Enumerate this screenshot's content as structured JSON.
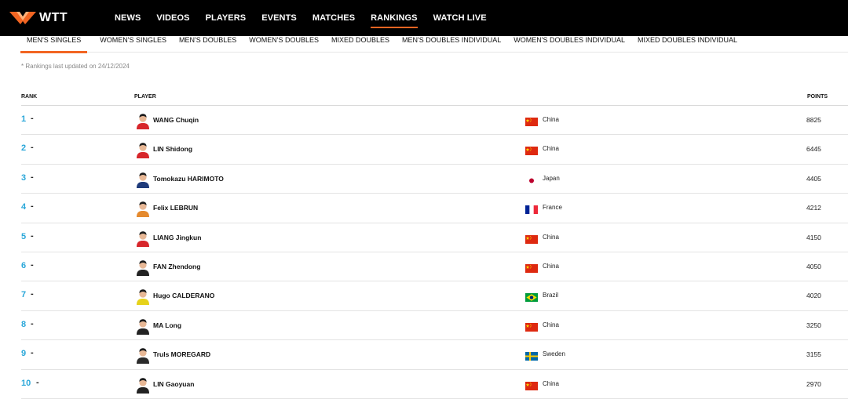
{
  "brand": {
    "name": "WTT"
  },
  "nav": {
    "items": [
      {
        "label": "NEWS"
      },
      {
        "label": "VIDEOS"
      },
      {
        "label": "PLAYERS"
      },
      {
        "label": "EVENTS"
      },
      {
        "label": "MATCHES"
      },
      {
        "label": "RANKINGS",
        "active": true
      },
      {
        "label": "WATCH LIVE"
      }
    ]
  },
  "subtabs": {
    "items": [
      {
        "label": "MEN'S SINGLES",
        "active": true
      },
      {
        "label": "WOMEN'S SINGLES"
      },
      {
        "label": "MEN'S DOUBLES"
      },
      {
        "label": "WOMEN'S DOUBLES"
      },
      {
        "label": "MIXED DOUBLES"
      },
      {
        "label": "MEN'S DOUBLES INDIVIDUAL"
      },
      {
        "label": "WOMEN'S DOUBLES INDIVIDUAL"
      },
      {
        "label": "MIXED DOUBLES INDIVIDUAL"
      }
    ]
  },
  "updated_text": "* Rankings last updated on 24/12/2024",
  "table": {
    "headers": {
      "rank": "RANK",
      "player": "PLAYER",
      "points": "POINTS"
    },
    "rows": [
      {
        "rank": "1",
        "change": "-",
        "player": "WANG Chuqin",
        "country": "China",
        "flag": "china-flag",
        "points": "8825",
        "shirt": "#d7262b"
      },
      {
        "rank": "2",
        "change": "-",
        "player": "LIN Shidong",
        "country": "China",
        "flag": "china-flag",
        "points": "6445",
        "shirt": "#d7262b"
      },
      {
        "rank": "3",
        "change": "-",
        "player": "Tomokazu HARIMOTO",
        "country": "Japan",
        "flag": "japan-flag",
        "points": "4405",
        "shirt": "#1f3b7a"
      },
      {
        "rank": "4",
        "change": "-",
        "player": "Felix LEBRUN",
        "country": "France",
        "flag": "france-flag",
        "points": "4212",
        "shirt": "#e58a2e"
      },
      {
        "rank": "5",
        "change": "-",
        "player": "LIANG Jingkun",
        "country": "China",
        "flag": "china-flag",
        "points": "4150",
        "shirt": "#d7262b"
      },
      {
        "rank": "6",
        "change": "-",
        "player": "FAN Zhendong",
        "country": "China",
        "flag": "china-flag",
        "points": "4050",
        "shirt": "#222222"
      },
      {
        "rank": "7",
        "change": "-",
        "player": "Hugo CALDERANO",
        "country": "Brazil",
        "flag": "brazil-flag",
        "points": "4020",
        "shirt": "#e6d21a"
      },
      {
        "rank": "8",
        "change": "-",
        "player": "MA Long",
        "country": "China",
        "flag": "china-flag",
        "points": "3250",
        "shirt": "#222222"
      },
      {
        "rank": "9",
        "change": "-",
        "player": "Truls MOREGARD",
        "country": "Sweden",
        "flag": "sweden-flag",
        "points": "3155",
        "shirt": "#2a2a2a"
      },
      {
        "rank": "10",
        "change": "-",
        "player": "LIN Gaoyuan",
        "country": "China",
        "flag": "china-flag",
        "points": "2970",
        "shirt": "#222222"
      }
    ]
  },
  "colors": {
    "accent": "#f26522",
    "rank": "#2aa7d9",
    "topbar": "#000000"
  }
}
